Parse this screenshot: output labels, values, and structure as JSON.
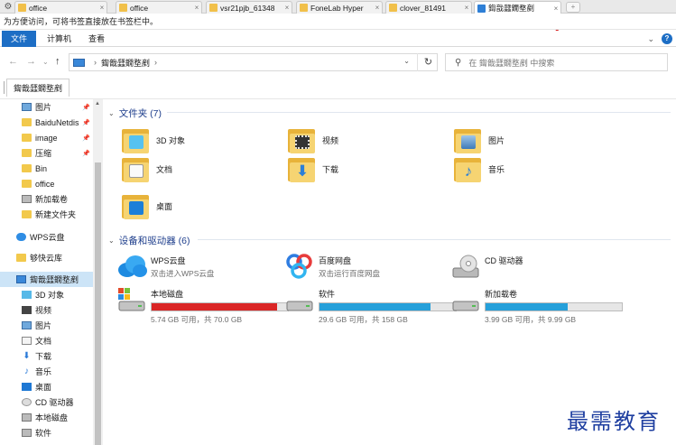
{
  "browser": {
    "tabs": [
      {
        "label": "office",
        "active": false
      },
      {
        "label": "office",
        "active": false
      },
      {
        "label": "vsr21pjb_61348",
        "active": false
      },
      {
        "label": "FoneLab Hyper",
        "active": false
      },
      {
        "label": "clover_81491",
        "active": false
      },
      {
        "label": "鍧戠瓥鐗堥剷",
        "active": true
      }
    ],
    "close_glyph": "×",
    "new_tab_glyph": "+",
    "hint": "为方便访问，可将书签直接放在书签栏中。"
  },
  "ribbon": {
    "tabs": [
      "文件",
      "计算机",
      "查看"
    ]
  },
  "address": {
    "location": "鍧戠瓥鐗堥剷",
    "search_placeholder": "在 鍧戠瓥鐗堥剷 中搜索"
  },
  "location_tab": "鍧戠瓥鐗堥剷",
  "sidebar": {
    "items": [
      {
        "label": "图片",
        "icon": "pictures-icon",
        "pinned": true
      },
      {
        "label": "BaiduNetdis",
        "icon": "folder-icon",
        "pinned": true
      },
      {
        "label": "image",
        "icon": "folder-icon",
        "pinned": true
      },
      {
        "label": "压缩",
        "icon": "folder-icon",
        "pinned": true
      },
      {
        "label": "Bin",
        "icon": "folder-icon",
        "pinned": false
      },
      {
        "label": "office",
        "icon": "folder-icon",
        "pinned": false
      },
      {
        "label": "新加载卷",
        "icon": "drive-icon",
        "pinned": false
      },
      {
        "label": "新建文件夹",
        "icon": "folder-icon",
        "pinned": false
      },
      {
        "label": "WPS云盘",
        "icon": "cloud-icon",
        "pinned": false
      },
      {
        "label": "够快云库",
        "icon": "folder-icon",
        "pinned": false
      },
      {
        "label": "鍧戠瓥鐗堥剷",
        "icon": "computer-icon",
        "pinned": false,
        "selected": true
      },
      {
        "label": "3D 对象",
        "icon": "3d-objects-icon",
        "pinned": false
      },
      {
        "label": "视频",
        "icon": "video-icon",
        "pinned": false
      },
      {
        "label": "图片",
        "icon": "pictures-icon",
        "pinned": false
      },
      {
        "label": "文档",
        "icon": "documents-icon",
        "pinned": false
      },
      {
        "label": "下载",
        "icon": "downloads-icon",
        "pinned": false
      },
      {
        "label": "音乐",
        "icon": "music-icon",
        "pinned": false
      },
      {
        "label": "桌面",
        "icon": "desktop-icon",
        "pinned": false
      },
      {
        "label": "CD 驱动器",
        "icon": "cd-drive-icon",
        "pinned": false
      },
      {
        "label": "本地磁盘",
        "icon": "drive-icon",
        "pinned": false
      },
      {
        "label": "软件",
        "icon": "drive-icon",
        "pinned": false
      }
    ]
  },
  "folders_group": {
    "title": "文件夹 (7)",
    "items": [
      {
        "label": "3D 对象",
        "icon": "3d-objects-icon"
      },
      {
        "label": "视频",
        "icon": "video-icon"
      },
      {
        "label": "图片",
        "icon": "pictures-icon"
      },
      {
        "label": "文档",
        "icon": "documents-icon"
      },
      {
        "label": "下载",
        "icon": "downloads-icon"
      },
      {
        "label": "音乐",
        "icon": "music-icon"
      },
      {
        "label": "桌面",
        "icon": "desktop-icon"
      }
    ]
  },
  "devices_group": {
    "title": "设备和驱动器 (6)",
    "items": [
      {
        "name": "WPS云盘",
        "sub": "双击进入WPS云盘",
        "icon": "wps-cloud-icon"
      },
      {
        "name": "百度网盘",
        "sub": "双击运行百度网盘",
        "icon": "baidu-netdisk-icon"
      },
      {
        "name": "CD 驱动器",
        "sub": "",
        "icon": "cd-drive-icon"
      },
      {
        "name": "本地磁盘",
        "free": "5.74 GB 可用，共 70.0 GB",
        "used_fraction": 0.918,
        "bar_color": "#da2626",
        "icon": "windows-drive-icon"
      },
      {
        "name": "软件",
        "free": "29.6 GB 可用，共 158 GB",
        "used_fraction": 0.813,
        "bar_color": "#26a0da",
        "icon": "drive-icon"
      },
      {
        "name": "新加载卷",
        "free": "3.99 GB 可用，共 9.99 GB",
        "used_fraction": 0.6,
        "bar_color": "#26a0da",
        "icon": "drive-icon"
      }
    ]
  },
  "watermark": "最需教育"
}
